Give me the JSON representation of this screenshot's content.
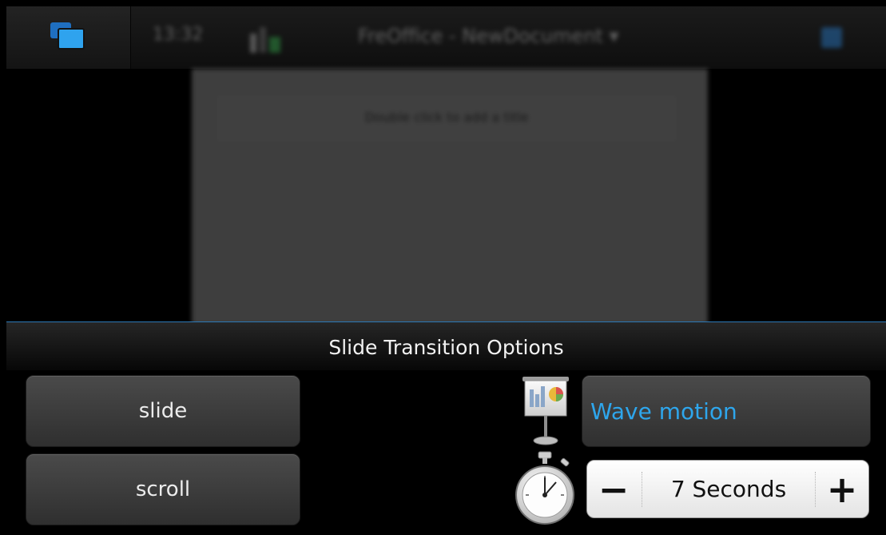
{
  "background_app": {
    "clock": "13:32",
    "title": "FreOffice - NewDocument ▾",
    "slide_hint": "Double click to add a title"
  },
  "icons": {
    "switcher": "task-switcher-icon",
    "signal": "signal-strength-icon",
    "close": "close-icon",
    "presentation": "presentation-icon",
    "stopwatch": "stopwatch-icon"
  },
  "sheet": {
    "title": "Slide Transition Options",
    "options": [
      {
        "label": "slide"
      },
      {
        "label": "scroll"
      }
    ],
    "effect": {
      "label": "Wave motion",
      "color": "#2ea6ec"
    },
    "duration": {
      "minus": "−",
      "value": "7 Seconds",
      "plus": "+"
    }
  },
  "colors": {
    "accent": "#2ea6ec",
    "sheet_border": "#2b78b6"
  }
}
